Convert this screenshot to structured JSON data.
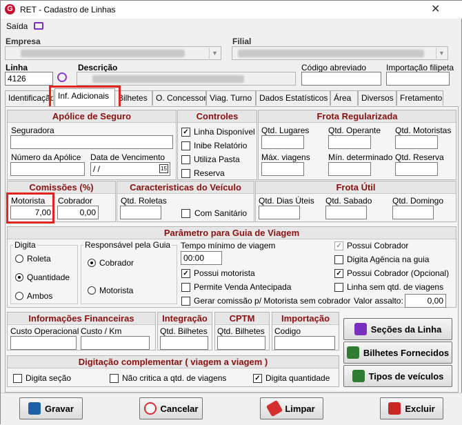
{
  "window": {
    "title": "RET - Cadastro de Linhas",
    "menu_saida": "Saída"
  },
  "header": {
    "empresa_label": "Empresa",
    "filial_label": "Filial",
    "linha_label": "Linha",
    "linha_value": "4126",
    "descricao_label": "Descrição",
    "codigo_abreviado_label": "Código abreviado",
    "importacao_filipeta_label": "Importação filipeta"
  },
  "tabs": [
    "Identificação",
    "Inf. Adicionais",
    "Bilhetes",
    "O. Concessor",
    "Viag. Turno",
    "Dados Estatísticos",
    "Área",
    "Diversos",
    "Fretamento"
  ],
  "apolice": {
    "title": "Apólice de Seguro",
    "seguradora": "Seguradora",
    "numero": "Número da Apólice",
    "data_venc": "Data de Vencimento",
    "data_value": "/ /",
    "cal_label": "15"
  },
  "controles": {
    "title": "Controles",
    "items": [
      {
        "label": "Linha Disponível",
        "checked": true
      },
      {
        "label": "Inibe Relatório",
        "checked": false
      },
      {
        "label": "Utiliza Pasta",
        "checked": false
      },
      {
        "label": "Reserva",
        "checked": false
      }
    ]
  },
  "frota_reg": {
    "title": "Frota Regularizada",
    "qtd_lugares": "Qtd. Lugares",
    "qtd_operante": "Qtd. Operante",
    "qtd_motoristas": "Qtd. Motoristas",
    "max_viagens": "Máx. viagens",
    "min_determinado": "Mín. determinado",
    "qtd_reserva": "Qtd. Reserva"
  },
  "comissoes": {
    "title": "Comissões (%)",
    "motorista_label": "Motorista",
    "motorista_value": "7,00",
    "cobrador_label": "Cobrador",
    "cobrador_value": "0,00"
  },
  "veiculo": {
    "title": "Caracteristicas do Veículo",
    "qtd_roletas": "Qtd. Roletas",
    "com_sanitario": "Com Sanitário"
  },
  "frota_util": {
    "title": "Frota Útil",
    "dias_uteis": "Qtd. Dias Úteis",
    "sabado": "Qtd. Sabado",
    "domingo": "Qtd. Domingo"
  },
  "parametro": {
    "title": "Parâmetro para Guia de Viagem",
    "digita_label": "Digita",
    "digita_opts": [
      {
        "label": "Roleta",
        "on": false
      },
      {
        "label": "Quantidade",
        "on": true
      },
      {
        "label": "Ambos",
        "on": false
      }
    ],
    "resp_label": "Responsável pela Guia",
    "resp_opts": [
      {
        "label": "Cobrador",
        "on": true
      },
      {
        "label": "Motorista",
        "on": false
      }
    ],
    "tempo_label": "Tempo mínimo de viagem",
    "tempo_value": "00:00",
    "mid_checks": [
      {
        "label": "Possui motorista",
        "checked": true
      },
      {
        "label": "Permite Venda Antecipada",
        "checked": false
      },
      {
        "label": "Gerar comissão p/ Motorista sem cobrador",
        "checked": false
      }
    ],
    "right_checks": [
      {
        "label": "Possui Cobrador",
        "checked": true,
        "disabled": true
      },
      {
        "label": "Digita Agência na guia",
        "checked": false
      },
      {
        "label": "Possui Cobrador (Opcional)",
        "checked": true
      },
      {
        "label": "Linha sem  qtd. de viagens",
        "checked": false
      }
    ],
    "valor_assalto_label": "Valor assalto:",
    "valor_assalto_value": "0,00"
  },
  "fin": {
    "title": "Informações Financeiras",
    "custo_operacional": "Custo Operacional",
    "custo_km": "Custo / Km"
  },
  "integracao": {
    "title": "Integração",
    "qtd_bilhetes": "Qtd. Bilhetes"
  },
  "cptm": {
    "title": "CPTM",
    "qtd_bilhetes": "Qtd. Bilhetes"
  },
  "importacao": {
    "title": "Importação",
    "codigo": "Codigo"
  },
  "side_buttons": [
    "Seções da Linha",
    "Bilhetes Fornecidos",
    "Tipos de veículos"
  ],
  "dig_comp": {
    "title": "Digitação complementar ( viagem a viagem )",
    "items": [
      {
        "label": "Digita seção",
        "checked": false
      },
      {
        "label": "Não critica a qtd. de  viagens",
        "checked": false
      },
      {
        "label": "Digita quantidade",
        "checked": true
      }
    ]
  },
  "bottom_buttons": {
    "gravar": "Gravar",
    "cancelar": "Cancelar",
    "limpar": "Limpar",
    "excluir": "Excluir"
  },
  "colors": {
    "section_title": "#8b1010",
    "highlight": "#e3231e"
  }
}
